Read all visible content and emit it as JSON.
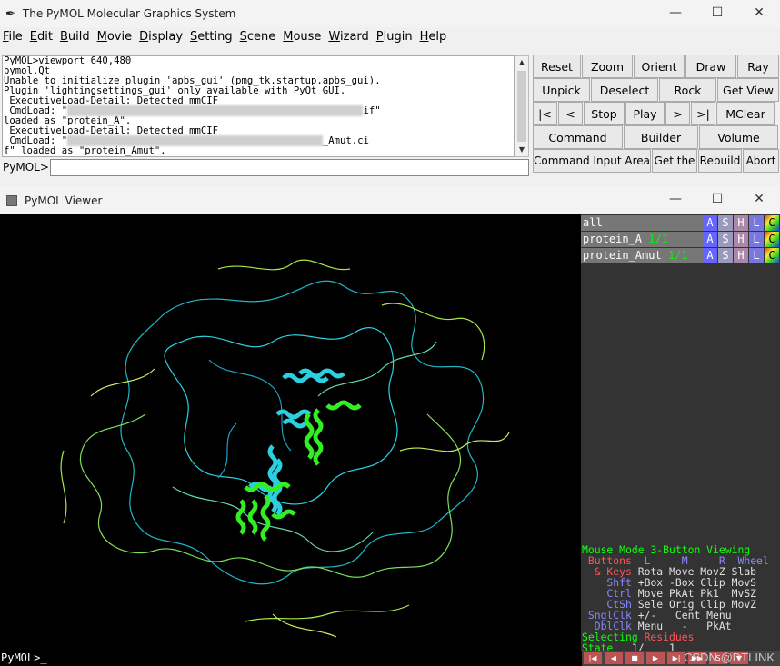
{
  "main_window": {
    "title": "The PyMOL Molecular Graphics System",
    "controls": {
      "minimize": "—",
      "maximize": "☐",
      "close": "✕"
    }
  },
  "menu": [
    "File",
    "Edit",
    "Build",
    "Movie",
    "Display",
    "Setting",
    "Scene",
    "Mouse",
    "Wizard",
    "Plugin",
    "Help"
  ],
  "log_lines": [
    "PyMOL>viewport 640,480",
    "pymol.Qt",
    "Unable to initialize plugin 'apbs_gui' (pmg_tk.startup.apbs_gui).",
    "Plugin 'lightingsettings_gui' only available with PyQt GUI.",
    " ExecutiveLoad-Detail: Detected mmCIF",
    " CmdLoad: \"",
    "loaded as \"protein_A\".",
    " ExecutiveLoad-Detail: Detected mmCIF",
    " CmdLoad: \"",
    "f\" loaded as \"protein_Amut\"."
  ],
  "log_fragments": {
    "line6_tail": "if\"",
    "line9_tail": "_Amut.ci"
  },
  "command_prompt": "PyMOL>",
  "buttons": {
    "row1": [
      "Reset",
      "Zoom",
      "Orient",
      "Draw",
      "Ray"
    ],
    "row2": [
      "Unpick",
      "Deselect",
      "Rock",
      "Get View"
    ],
    "row3": [
      "|<",
      "<",
      "Stop",
      "Play",
      ">",
      ">|",
      "MClear"
    ],
    "row4": [
      "Command",
      "Builder",
      "Volume"
    ],
    "row5": [
      "Command Input Area",
      "Get the",
      "Rebuild",
      "Abort"
    ]
  },
  "viewer": {
    "title": "PyMOL Viewer",
    "objects": [
      {
        "name": "all",
        "state": ""
      },
      {
        "name": "protein_A",
        "state": "1/1"
      },
      {
        "name": "protein_Amut",
        "state": "1/1"
      }
    ],
    "object_buttons": [
      "A",
      "S",
      "H",
      "L",
      "C"
    ],
    "mouse_mode": {
      "title_a": "Mouse Mode ",
      "title_b": "3-Button Viewing",
      "head": [
        " Buttons",
        "  L",
        "     M",
        "     R",
        "  Wheel"
      ],
      "rows": [
        {
          "k": "  & Keys",
          "v": " Rota Move MovZ Slab"
        },
        {
          "k": "    Shft",
          "v": " +Box -Box Clip MovS"
        },
        {
          "k": "    Ctrl",
          "v": " Move PkAt Pk1  MvSZ"
        },
        {
          "k": "    CtSh",
          "v": " Sele Orig Clip MovZ"
        },
        {
          "k": " SnglClk",
          "v": " +/-   Cent Menu"
        },
        {
          "k": "  DblClk",
          "v": " Menu   -   PkAt"
        }
      ],
      "selecting_a": "Selecting ",
      "selecting_b": "Residues",
      "state_label": "State",
      "state_value": "   1/    1"
    },
    "command_prompt": "PyMOL>_",
    "watermark": "CSDN @DTLINK"
  },
  "colors": {
    "cyan": "#2ad0e0",
    "green": "#33ee22",
    "lime": "#c8f060"
  }
}
